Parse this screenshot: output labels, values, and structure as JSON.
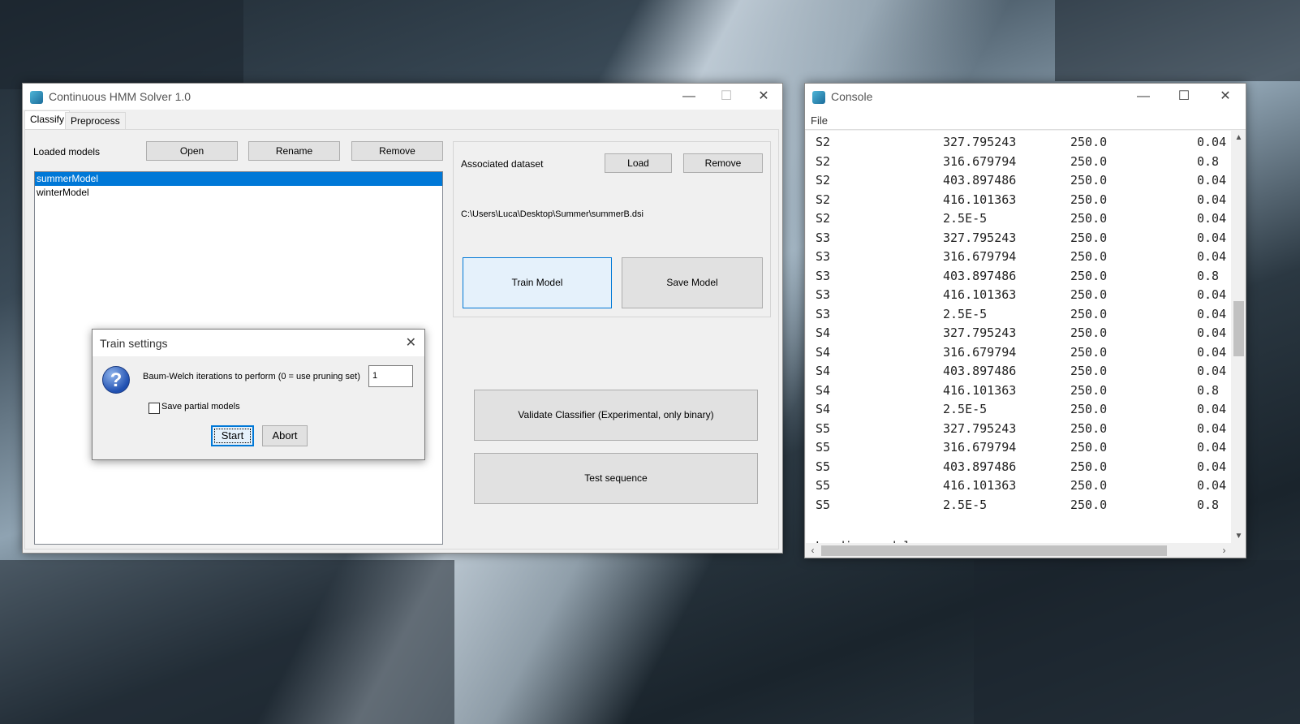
{
  "main_window": {
    "title": "Continuous HMM Solver 1.0",
    "tabs": [
      {
        "label": "Classify"
      },
      {
        "label": "Preprocess"
      }
    ],
    "loaded_models_label": "Loaded models",
    "open_label": "Open",
    "rename_label": "Rename",
    "remove_label": "Remove",
    "models": [
      "summerModel",
      "winterModel"
    ],
    "selected_model": "summerModel",
    "associated_dataset_label": "Associated dataset",
    "load_label": "Load",
    "dataset_remove_label": "Remove",
    "dataset_path": "C:\\Users\\Luca\\Desktop\\Summer\\summerB.dsi",
    "train_model_label": "Train Model",
    "save_model_label": "Save Model",
    "validate_label": "Validate Classifier (Experimental, only binary)",
    "test_sequence_label": "Test sequence"
  },
  "dialog": {
    "title": "Train settings",
    "prompt": "Baum-Welch iterations to perform (0 = use pruning set)",
    "iterations_value": "1",
    "save_partial_label": "Save partial models",
    "save_partial_checked": false,
    "start_label": "Start",
    "abort_label": "Abort"
  },
  "console": {
    "title": "Console",
    "menu_file": "File",
    "rows": [
      [
        "S2",
        "327.795243",
        "250.0",
        "0.04"
      ],
      [
        "S2",
        "316.679794",
        "250.0",
        "0.8"
      ],
      [
        "S2",
        "403.897486",
        "250.0",
        "0.04"
      ],
      [
        "S2",
        "416.101363",
        "250.0",
        "0.04"
      ],
      [
        "S2",
        "2.5E-5",
        "250.0",
        "0.04"
      ],
      [
        "S3",
        "327.795243",
        "250.0",
        "0.04"
      ],
      [
        "S3",
        "316.679794",
        "250.0",
        "0.04"
      ],
      [
        "S3",
        "403.897486",
        "250.0",
        "0.8"
      ],
      [
        "S3",
        "416.101363",
        "250.0",
        "0.04"
      ],
      [
        "S3",
        "2.5E-5",
        "250.0",
        "0.04"
      ],
      [
        "S4",
        "327.795243",
        "250.0",
        "0.04"
      ],
      [
        "S4",
        "316.679794",
        "250.0",
        "0.04"
      ],
      [
        "S4",
        "403.897486",
        "250.0",
        "0.04"
      ],
      [
        "S4",
        "416.101363",
        "250.0",
        "0.8"
      ],
      [
        "S4",
        "2.5E-5",
        "250.0",
        "0.04"
      ],
      [
        "S5",
        "327.795243",
        "250.0",
        "0.04"
      ],
      [
        "S5",
        "316.679794",
        "250.0",
        "0.04"
      ],
      [
        "S5",
        "403.897486",
        "250.0",
        "0.04"
      ],
      [
        "S5",
        "416.101363",
        "250.0",
        "0.04"
      ],
      [
        "S5",
        "2.5E-5",
        "250.0",
        "0.8"
      ]
    ],
    "trailing_line": "Loading model..."
  },
  "icons": {
    "app": "app-icon",
    "question": "question-icon"
  },
  "colors": {
    "selection": "#0078d7",
    "train_button_bg": "#e5f1fb",
    "train_button_border": "#0078d7"
  }
}
